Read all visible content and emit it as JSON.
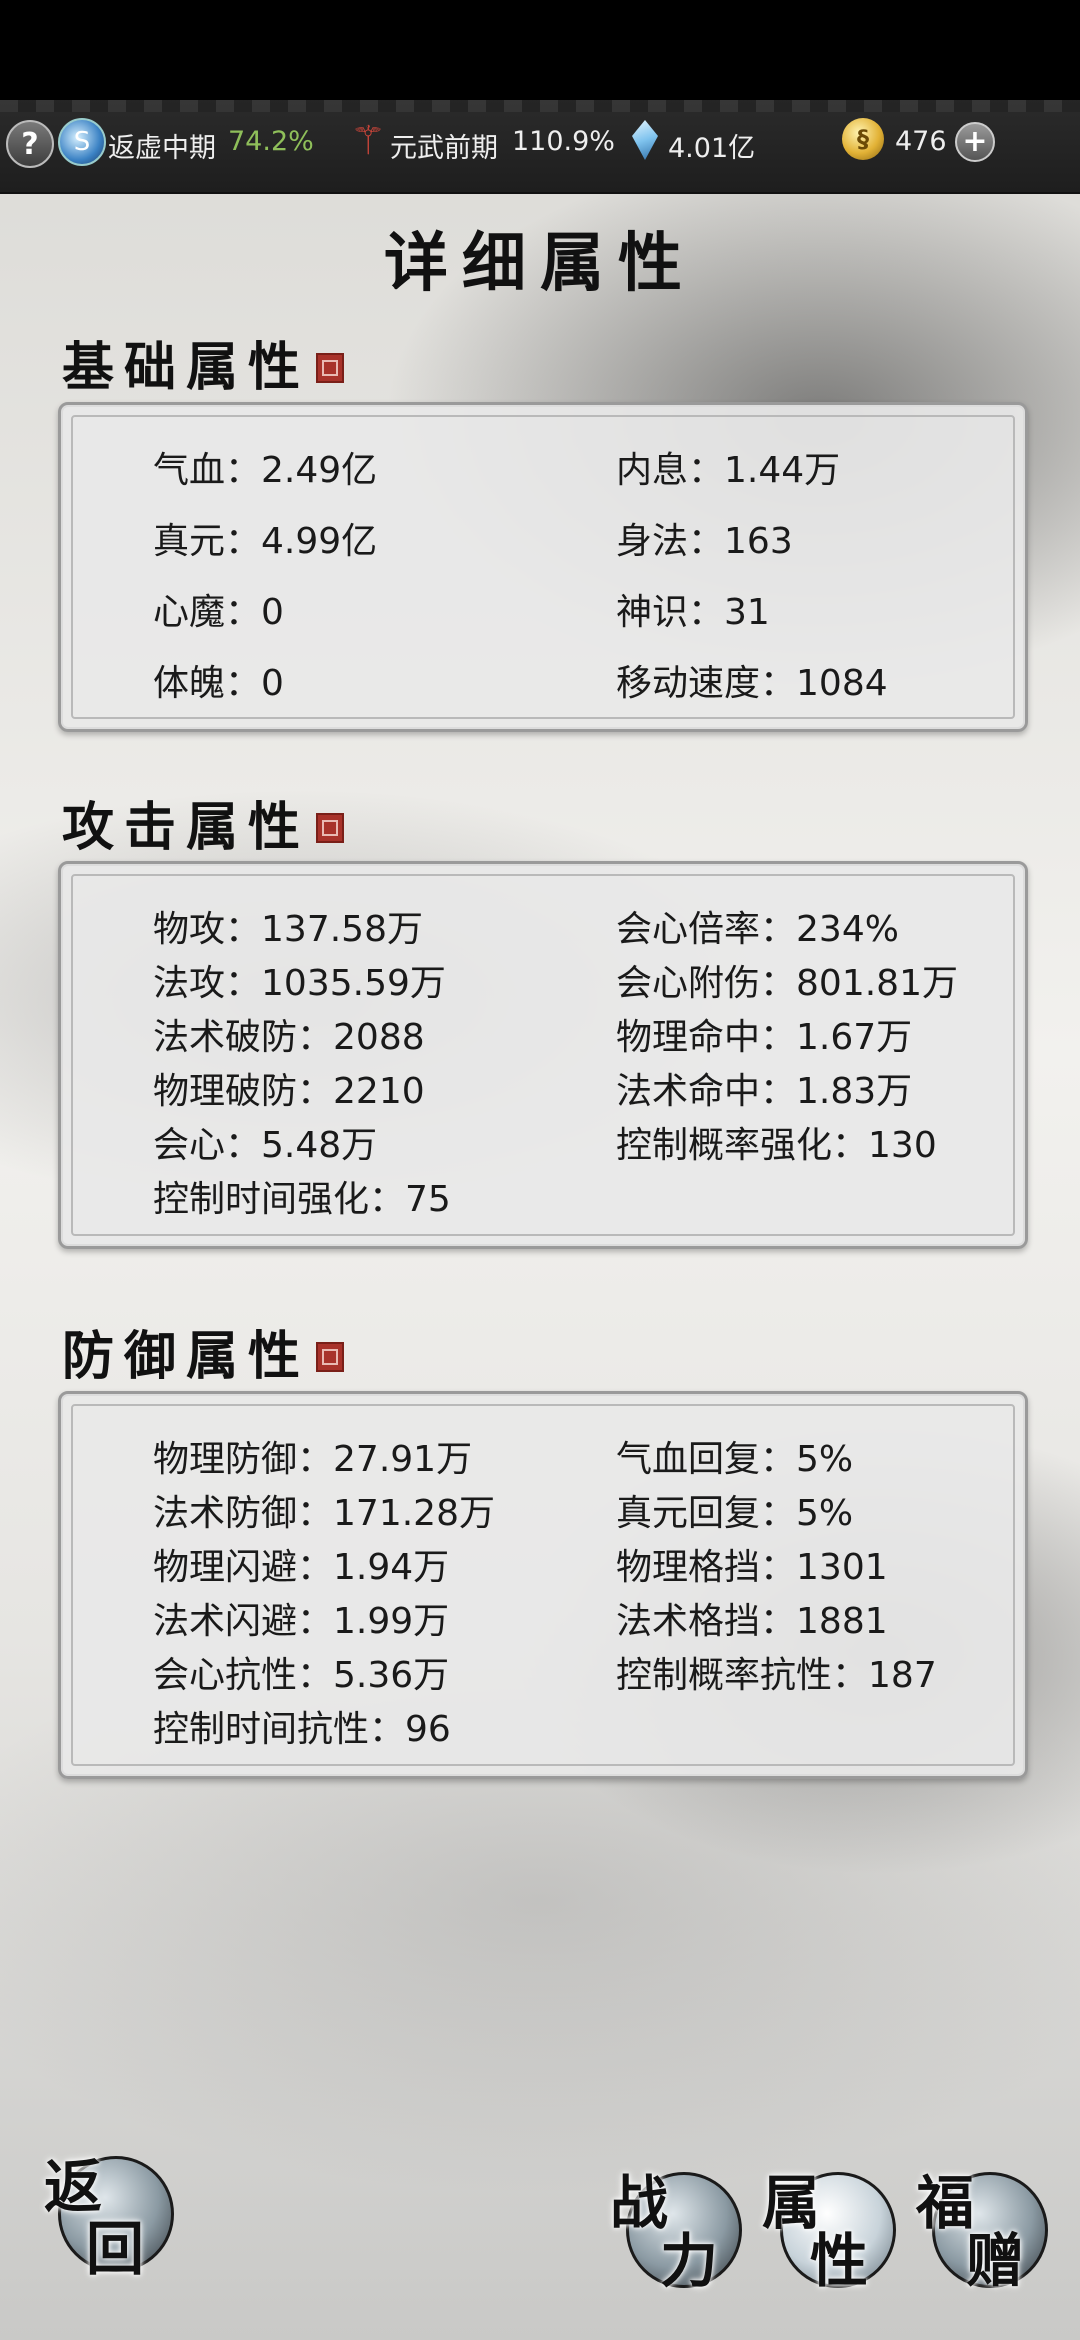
{
  "status_bar": {
    "help_label": "?",
    "realm_label": "返虚中期",
    "realm_pct": "74.2%",
    "weapon_label": "元武前期",
    "weapon_pct": "110.9%",
    "gem_value": "4.01亿",
    "coin_value": "476",
    "plus_label": "+"
  },
  "page_title": "详细属性",
  "sections": {
    "basic": {
      "title": "基础属性",
      "left": [
        {
          "label": "气血：",
          "value": "2.49亿"
        },
        {
          "label": "真元：",
          "value": "4.99亿"
        },
        {
          "label": "心魔：",
          "value": "0"
        },
        {
          "label": "体魄：",
          "value": "0"
        }
      ],
      "right": [
        {
          "label": "内息：",
          "value": "1.44万"
        },
        {
          "label": "身法：",
          "value": "163"
        },
        {
          "label": "神识：",
          "value": "31"
        },
        {
          "label": "移动速度：",
          "value": "1084"
        }
      ]
    },
    "attack": {
      "title": "攻击属性",
      "left": [
        {
          "label": "物攻：",
          "value": "137.58万"
        },
        {
          "label": "法攻：",
          "value": "1035.59万"
        },
        {
          "label": "法术破防：",
          "value": "2088"
        },
        {
          "label": "物理破防：",
          "value": "2210"
        },
        {
          "label": "会心：",
          "value": "5.48万"
        },
        {
          "label": "控制时间强化：",
          "value": "75"
        }
      ],
      "right": [
        {
          "label": "会心倍率：",
          "value": "234%"
        },
        {
          "label": "会心附伤：",
          "value": "801.81万"
        },
        {
          "label": "物理命中：",
          "value": "1.67万"
        },
        {
          "label": "法术命中：",
          "value": "1.83万"
        },
        {
          "label": "控制概率强化：",
          "value": "130"
        }
      ]
    },
    "defense": {
      "title": "防御属性",
      "left": [
        {
          "label": "物理防御：",
          "value": "27.91万"
        },
        {
          "label": "法术防御：",
          "value": "171.28万"
        },
        {
          "label": "物理闪避：",
          "value": "1.94万"
        },
        {
          "label": "法术闪避：",
          "value": "1.99万"
        },
        {
          "label": "会心抗性：",
          "value": "5.36万"
        },
        {
          "label": "控制时间抗性：",
          "value": "96"
        }
      ],
      "right": [
        {
          "label": "气血回复：",
          "value": "5%"
        },
        {
          "label": "真元回复：",
          "value": "5%"
        },
        {
          "label": "物理格挡：",
          "value": "1301"
        },
        {
          "label": "法术格挡：",
          "value": "1881"
        },
        {
          "label": "控制概率抗性：",
          "value": "187"
        }
      ]
    }
  },
  "nav": {
    "back": [
      "返",
      "回"
    ],
    "power": [
      "战",
      "力"
    ],
    "attributes": [
      "属",
      "性"
    ],
    "blessing": [
      "福",
      "赠"
    ]
  }
}
